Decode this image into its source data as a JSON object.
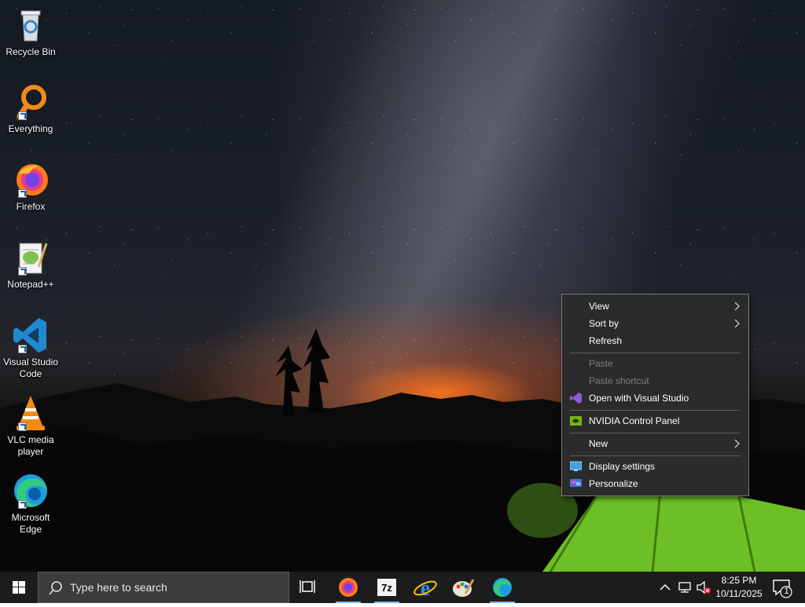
{
  "desktop": {
    "icons": [
      {
        "label": "Recycle Bin",
        "icon": "recycle-bin-icon"
      },
      {
        "label": "Everything",
        "icon": "everything-search-icon"
      },
      {
        "label": "Firefox",
        "icon": "firefox-icon"
      },
      {
        "label": "Notepad++",
        "icon": "notepad-plus-plus-icon"
      },
      {
        "label": "Visual Studio Code",
        "icon": "vscode-icon"
      },
      {
        "label": "VLC media player",
        "icon": "vlc-icon"
      },
      {
        "label": "Microsoft Edge",
        "icon": "edge-icon"
      }
    ]
  },
  "context_menu": {
    "items": [
      {
        "label": "View",
        "has_submenu": true,
        "enabled": true
      },
      {
        "label": "Sort by",
        "has_submenu": true,
        "enabled": true
      },
      {
        "label": "Refresh",
        "enabled": true
      },
      {
        "label": "Paste",
        "enabled": false
      },
      {
        "label": "Paste shortcut",
        "enabled": false
      },
      {
        "label": "Open with Visual Studio",
        "icon": "visual-studio-icon",
        "enabled": true
      },
      {
        "label": "NVIDIA Control Panel",
        "icon": "nvidia-icon",
        "enabled": true
      },
      {
        "label": "New",
        "has_submenu": true,
        "enabled": true
      },
      {
        "label": "Display settings",
        "icon": "display-icon",
        "enabled": true
      },
      {
        "label": "Personalize",
        "icon": "personalize-icon",
        "enabled": true
      }
    ]
  },
  "taskbar": {
    "search_placeholder": "Type here to search",
    "pinned": [
      "task-view-icon",
      "firefox-icon",
      "7zip-icon",
      "internet-explorer-icon",
      "paint-icon",
      "edge-icon"
    ],
    "clock": {
      "time": "8:25 PM",
      "date": "10/11/2025"
    },
    "notification_count": "1"
  },
  "colors": {
    "accent": "#76b9ed",
    "menu_bg": "#2b2b2b",
    "taskbar_bg": "#1c1c1c"
  }
}
